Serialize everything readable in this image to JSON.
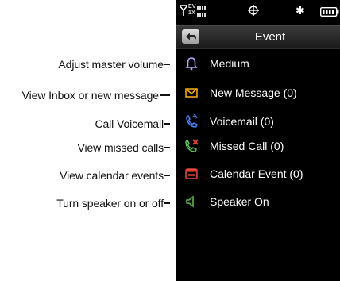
{
  "callouts": [
    "Adjust master volume",
    "View Inbox or new message",
    "Call Voicemail",
    "View missed calls",
    "View calendar events",
    "Turn speaker on or off"
  ],
  "status_bar": {
    "network_label_top": "EV",
    "network_label_bottom": "1X",
    "icons": [
      "signal-icon",
      "gps-icon",
      "bluetooth-icon",
      "battery-icon"
    ]
  },
  "header": {
    "title": "Event"
  },
  "menu": {
    "items": [
      {
        "label": "Medium",
        "icon": "bell-icon",
        "color": "#b9a3ff"
      },
      {
        "label": "New Message (0)",
        "icon": "envelope-icon",
        "color": "#f0a500"
      },
      {
        "label": "Voicemail (0)",
        "icon": "voicemail-icon",
        "color": "#4c86ff"
      },
      {
        "label": "Missed Call (0)",
        "icon": "missed-call-icon",
        "color": "#5ac85a"
      },
      {
        "label": "Calendar Event (0)",
        "icon": "calendar-icon",
        "color": "#e0443a"
      },
      {
        "label": "Speaker On",
        "icon": "speaker-icon",
        "color": "#5ab04a"
      }
    ]
  },
  "colors": {
    "screen_background": "#000000",
    "titlebar": "#2a2a2a"
  }
}
